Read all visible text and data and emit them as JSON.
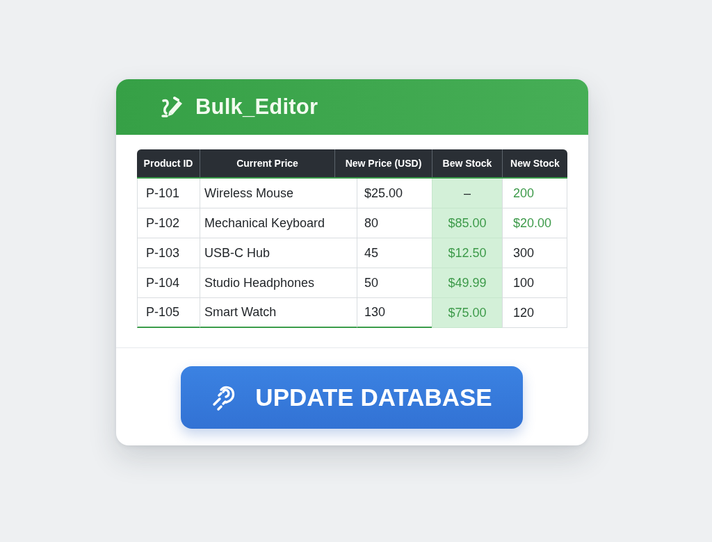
{
  "window": {
    "title": "Bulk_Editor"
  },
  "table": {
    "columns": [
      {
        "label": "Product ID",
        "highlighted": false
      },
      {
        "label": "Current Price",
        "highlighted": false
      },
      {
        "label": "New Price (USD)",
        "highlighted": false
      },
      {
        "label": "Bew Stock",
        "highlighted": true
      },
      {
        "label": "New Stock",
        "highlighted": false
      }
    ],
    "rows": [
      {
        "cells": [
          {
            "text": "P-101",
            "changed": false
          },
          {
            "text": "Wireless Mouse",
            "changed": false
          },
          {
            "text": "$25.00",
            "changed": false
          },
          {
            "text": "–",
            "changed": false
          },
          {
            "text": "200",
            "changed": true
          }
        ]
      },
      {
        "cells": [
          {
            "text": "P-102",
            "changed": false
          },
          {
            "text": "Mechanical Keyboard",
            "changed": false
          },
          {
            "text": "80",
            "changed": false
          },
          {
            "text": "$85.00",
            "changed": true
          },
          {
            "text": "$20.00",
            "changed": true
          }
        ]
      },
      {
        "cells": [
          {
            "text": "P-103",
            "changed": false
          },
          {
            "text": "USB-C Hub",
            "changed": false
          },
          {
            "text": "45",
            "changed": false
          },
          {
            "text": "$12.50",
            "changed": true
          },
          {
            "text": "300",
            "changed": false
          }
        ]
      },
      {
        "cells": [
          {
            "text": "P-104",
            "changed": false
          },
          {
            "text": "Studio Headphones",
            "changed": false
          },
          {
            "text": "50",
            "changed": false
          },
          {
            "text": "$49.99",
            "changed": true
          },
          {
            "text": "100",
            "changed": false
          }
        ]
      },
      {
        "cells": [
          {
            "text": "P-105",
            "changed": false
          },
          {
            "text": "Smart Watch",
            "changed": false
          },
          {
            "text": "130",
            "changed": false
          },
          {
            "text": "$75.00",
            "changed": true
          },
          {
            "text": "120",
            "changed": false
          }
        ]
      }
    ]
  },
  "primary_button": {
    "label": "UPDATE DATABASE"
  }
}
